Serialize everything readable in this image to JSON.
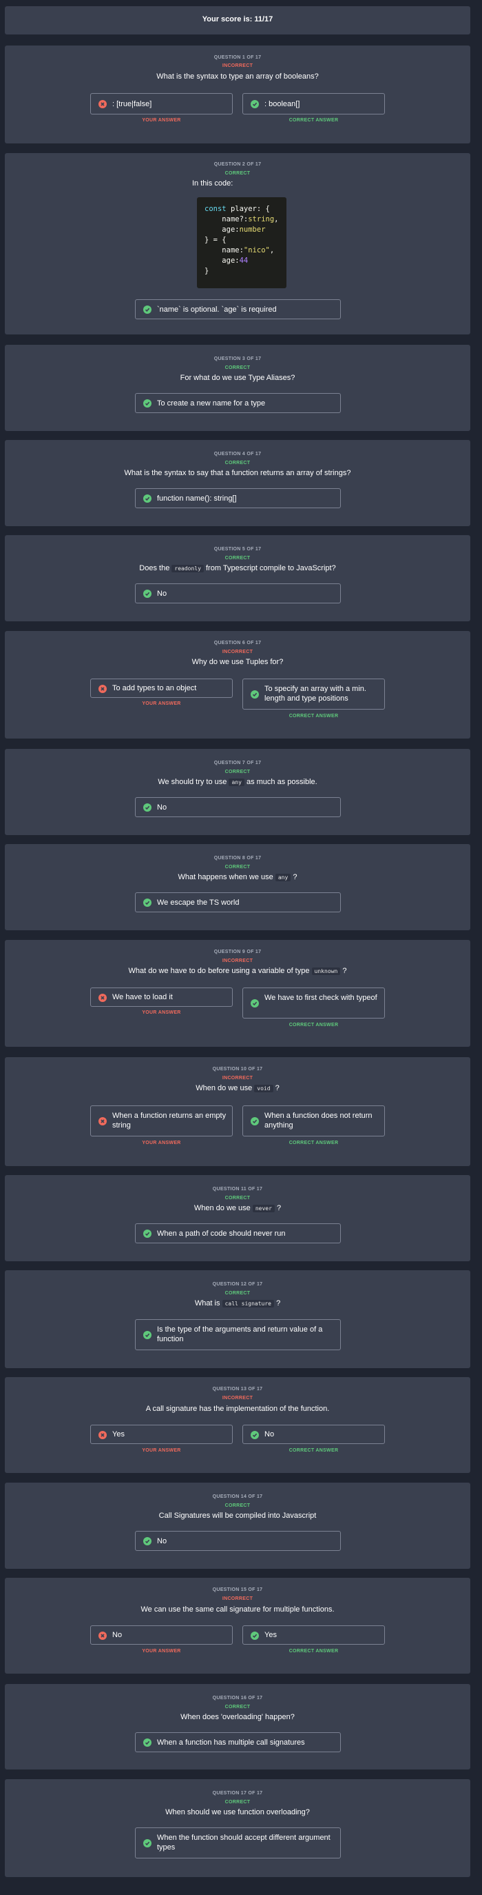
{
  "score_text": "Your score is: 11/17",
  "labels": {
    "your_answer": "YOUR ANSWER",
    "correct_answer": "CORRECT ANSWER"
  },
  "colors": {
    "correct": "#5fc97b",
    "incorrect": "#f06a5c",
    "card": "#3a404f",
    "background": "#1f2430"
  },
  "icons": {
    "correct": "check-circle-icon",
    "incorrect": "x-circle-icon"
  },
  "questions": [
    {
      "number": "QUESTION 1 OF 17",
      "status": "INCORRECT",
      "prompt": "What is the syntax to type an array of booleans?",
      "your_answer": ": [true|false]",
      "correct_answer": ": boolean[]"
    },
    {
      "number": "QUESTION 2 OF 17",
      "status": "CORRECT",
      "prompt": "In this code:",
      "code": [
        "const player: {",
        "    name?:string,",
        "    age:number",
        "} = {",
        "    name:\"nico\",",
        "    age:44",
        "}"
      ],
      "answer": "`name` is optional. `age` is required"
    },
    {
      "number": "QUESTION 3 OF 17",
      "status": "CORRECT",
      "prompt": "For what do we use Type Aliases?",
      "answer": "To create a new name for a type"
    },
    {
      "number": "QUESTION 4 OF 17",
      "status": "CORRECT",
      "prompt": "What is the syntax to say that a function returns an array of strings?",
      "answer": "function name(): string[]"
    },
    {
      "number": "QUESTION 5 OF 17",
      "status": "CORRECT",
      "prompt_before": "Does the",
      "prompt_code": "readonly",
      "prompt_after": "from Typescript compile to JavaScript?",
      "answer": "No"
    },
    {
      "number": "QUESTION 6 OF 17",
      "status": "INCORRECT",
      "prompt": "Why do we use Tuples for?",
      "your_answer": "To add types to an object",
      "correct_answer": "To specify an array with a min. length and type positions"
    },
    {
      "number": "QUESTION 7 OF 17",
      "status": "CORRECT",
      "prompt_before": "We should try to use",
      "prompt_code": "any",
      "prompt_after": "as much as possible.",
      "answer": "No"
    },
    {
      "number": "QUESTION 8 OF 17",
      "status": "CORRECT",
      "prompt_before": "What happens when we use",
      "prompt_code": "any",
      "prompt_after": "?",
      "answer": "We escape the TS world"
    },
    {
      "number": "QUESTION 9 OF 17",
      "status": "INCORRECT",
      "prompt_before": "What do we have to do before using a variable of type",
      "prompt_code": "unknown",
      "prompt_after": "?",
      "your_answer": "We have to load it",
      "correct_answer": "We have to first check with typeof"
    },
    {
      "number": "QUESTION 10 OF 17",
      "status": "INCORRECT",
      "prompt_before": "When do we use",
      "prompt_code": "void",
      "prompt_after": "?",
      "your_answer": "When a function returns an empty string",
      "correct_answer": "When a function does not return anything"
    },
    {
      "number": "QUESTION 11 OF 17",
      "status": "CORRECT",
      "prompt_before": "When do we use",
      "prompt_code": "never",
      "prompt_after": "?",
      "answer": "When a path of code should never run"
    },
    {
      "number": "QUESTION 12 OF 17",
      "status": "CORRECT",
      "prompt_before": "What is",
      "prompt_code": "call signature",
      "prompt_after": "?",
      "answer": "Is the type of the arguments and return value of a function"
    },
    {
      "number": "QUESTION 13 OF 17",
      "status": "INCORRECT",
      "prompt": "A call signature has the implementation of the function.",
      "your_answer": "Yes",
      "correct_answer": "No"
    },
    {
      "number": "QUESTION 14 OF 17",
      "status": "CORRECT",
      "prompt": "Call Signatures will be compiled into Javascript",
      "answer": "No"
    },
    {
      "number": "QUESTION 15 OF 17",
      "status": "INCORRECT",
      "prompt": "We can use the same call signature for multiple functions.",
      "your_answer": "No",
      "correct_answer": "Yes"
    },
    {
      "number": "QUESTION 16 OF 17",
      "status": "CORRECT",
      "prompt": "When does 'overloading' happen?",
      "answer": "When a function has multiple call signatures"
    },
    {
      "number": "QUESTION 17 OF 17",
      "status": "CORRECT",
      "prompt": "When should we use function overloading?",
      "answer": "When the function should accept different argument types"
    }
  ]
}
